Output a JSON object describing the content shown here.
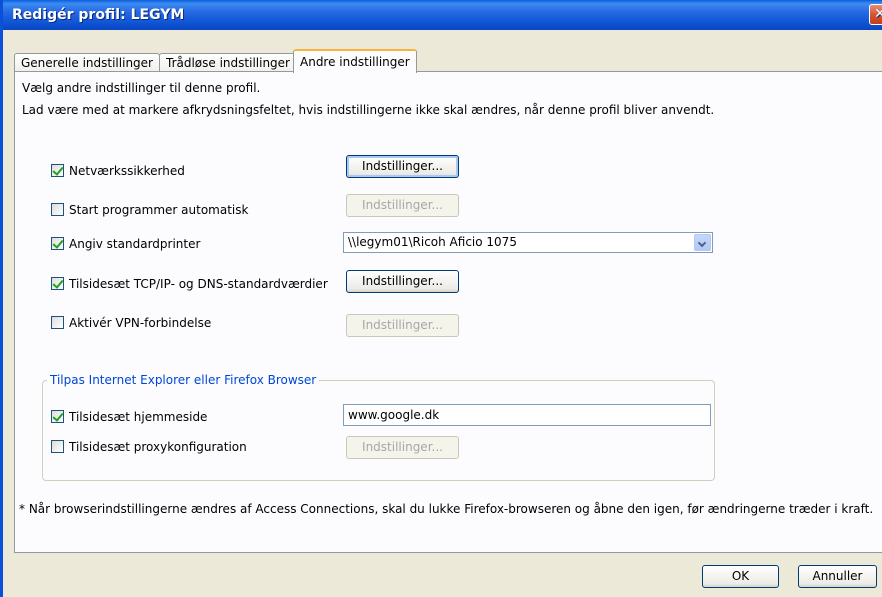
{
  "window": {
    "title": "Redigér profil: LEGYM",
    "close_glyph": "✕"
  },
  "tabs": [
    {
      "label": "Generelle indstillinger"
    },
    {
      "label": "Trådløse indstillinger"
    },
    {
      "label": "Andre indstillinger"
    }
  ],
  "intro": {
    "line1": "Vælg andre indstillinger til denne profil.",
    "line2": "Lad være med at markere afkrydsningsfeltet, hvis indstillingerne ikke skal ændres, når denne profil bliver anvendt."
  },
  "options": {
    "security": {
      "label": "Netværkssikkerhed",
      "checked": true,
      "button": "Indstillinger..."
    },
    "autostart": {
      "label": "Start programmer automatisk",
      "checked": false,
      "button": "Indstillinger..."
    },
    "printer": {
      "label": "Angiv standardprinter",
      "checked": true,
      "selected": "\\\\legym01\\Ricoh Aficio 1075"
    },
    "tcpip": {
      "label": "Tilsidesæt TCP/IP- og DNS-standardværdier",
      "checked": true,
      "button": "Indstillinger..."
    },
    "vpn": {
      "label": "Aktivér VPN-forbindelse",
      "checked": false,
      "button": "Indstillinger..."
    }
  },
  "browser_group": {
    "title": "Tilpas Internet Explorer eller Firefox Browser",
    "homepage": {
      "label": "Tilsidesæt hjemmeside",
      "checked": true,
      "value": "www.google.dk"
    },
    "proxy": {
      "label": "Tilsidesæt proxykonfiguration",
      "checked": false,
      "button": "Indstillinger..."
    }
  },
  "footnote": "* Når browserindstillingerne ændres af Access Connections, skal du lukke Firefox-browseren og åbne den igen, før ændringerne træder i kraft.",
  "buttons": {
    "ok": "OK",
    "cancel": "Annuller"
  }
}
